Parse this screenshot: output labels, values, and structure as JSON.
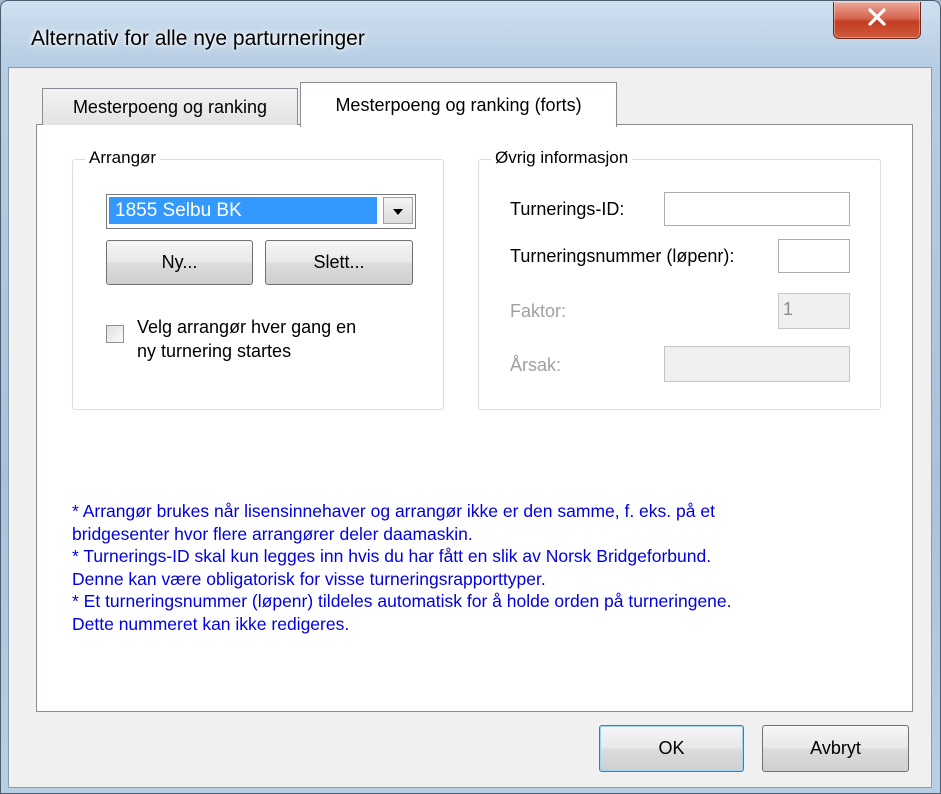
{
  "window": {
    "title": "Alternativ for alle nye parturneringer",
    "close_icon": "close-icon"
  },
  "tabs": [
    {
      "label": "Mesterpoeng og ranking",
      "active": false
    },
    {
      "label": "Mesterpoeng og ranking (forts)",
      "active": true
    }
  ],
  "arrangor": {
    "legend": "Arrangør",
    "selected": "1855 Selbu BK",
    "new_label": "Ny...",
    "delete_label": "Slett...",
    "checkbox_line1": "Velg arrangør hver gang en",
    "checkbox_line2": "ny turnering startes",
    "checkbox_checked": false
  },
  "info": {
    "legend": "Øvrig informasjon",
    "tournament_id_label": "Turnerings-ID:",
    "tournament_id_value": "",
    "tournament_number_label": "Turneringsnummer (løpenr):",
    "tournament_number_value": "",
    "factor_label": "Faktor:",
    "factor_value": "1",
    "reason_label": "Årsak:",
    "reason_value": ""
  },
  "notes": [
    "* Arrangør brukes når lisensinnehaver og arrangør ikke er den samme, f. eks. på et",
    "bridgesenter hvor flere arrangører deler daamaskin.",
    "* Turnerings-ID skal kun legges inn hvis du har fått en slik av Norsk Bridgeforbund.",
    "Denne kan være obligatorisk for visse turneringsrapporttyper.",
    "* Et turneringsnummer (løpenr) tildeles automatisk for å holde orden på turneringene.",
    "Dette nummeret kan ikke redigeres."
  ],
  "footer": {
    "ok_label": "OK",
    "cancel_label": "Avbryt"
  },
  "colors": {
    "selection": "#3399ff",
    "note_text": "#0000e0",
    "close_button": "#c33d22"
  }
}
